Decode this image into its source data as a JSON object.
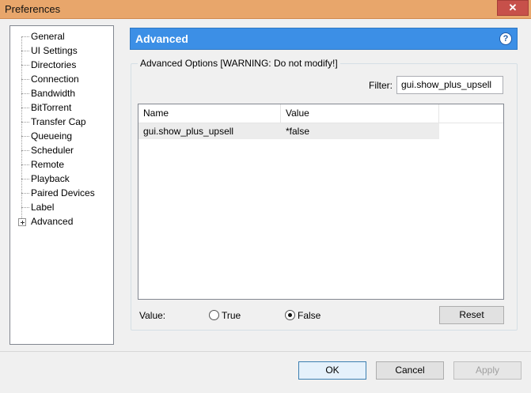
{
  "window": {
    "title": "Preferences",
    "close_glyph": "✕"
  },
  "nav": {
    "items": [
      {
        "label": "General"
      },
      {
        "label": "UI Settings"
      },
      {
        "label": "Directories"
      },
      {
        "label": "Connection"
      },
      {
        "label": "Bandwidth"
      },
      {
        "label": "BitTorrent"
      },
      {
        "label": "Transfer Cap"
      },
      {
        "label": "Queueing"
      },
      {
        "label": "Scheduler"
      },
      {
        "label": "Remote"
      },
      {
        "label": "Playback"
      },
      {
        "label": "Paired Devices"
      },
      {
        "label": "Label"
      },
      {
        "label": "Advanced",
        "expandable": true,
        "selected": true
      }
    ]
  },
  "panel": {
    "header": "Advanced",
    "help_glyph": "?",
    "group_title": "Advanced Options [WARNING: Do not modify!]",
    "filter_label": "Filter:",
    "filter_value": "gui.show_plus_upsell",
    "columns": {
      "name": "Name",
      "value": "Value"
    },
    "rows": [
      {
        "name": "gui.show_plus_upsell",
        "value": "*false"
      }
    ],
    "value_label": "Value:",
    "radio_true": "True",
    "radio_false": "False",
    "selected_radio": "false",
    "reset_label": "Reset"
  },
  "buttons": {
    "ok": "OK",
    "cancel": "Cancel",
    "apply": "Apply"
  },
  "colors": {
    "title_bar": "#e8a66b",
    "header": "#3c8fe6",
    "close": "#c7504a"
  },
  "icons": [
    "close-icon",
    "help-icon",
    "expand-plus-icon",
    "radio-icon"
  ]
}
